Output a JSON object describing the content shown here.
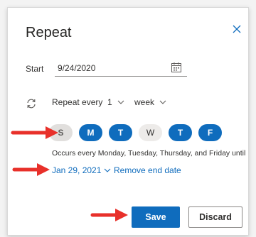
{
  "dialog": {
    "title": "Repeat",
    "close_icon": "close-icon"
  },
  "start": {
    "label": "Start",
    "date_value": "9/24/2020",
    "calendar_icon": "calendar-icon"
  },
  "repeat": {
    "icon": "repeat-icon",
    "label": "Repeat every",
    "count": "1",
    "unit": "week"
  },
  "days": [
    {
      "label": "S",
      "selected": false
    },
    {
      "label": "M",
      "selected": true
    },
    {
      "label": "T",
      "selected": true
    },
    {
      "label": "W",
      "selected": false
    },
    {
      "label": "T",
      "selected": true
    },
    {
      "label": "F",
      "selected": true
    }
  ],
  "summary": "Occurs every Monday, Tuesday, Thursday, and Friday until",
  "end": {
    "date": "Jan 29, 2021",
    "remove_label": "Remove end date"
  },
  "buttons": {
    "save": "Save",
    "discard": "Discard"
  },
  "colors": {
    "accent": "#0f6cbd",
    "annotation_arrow": "#e8302a"
  }
}
